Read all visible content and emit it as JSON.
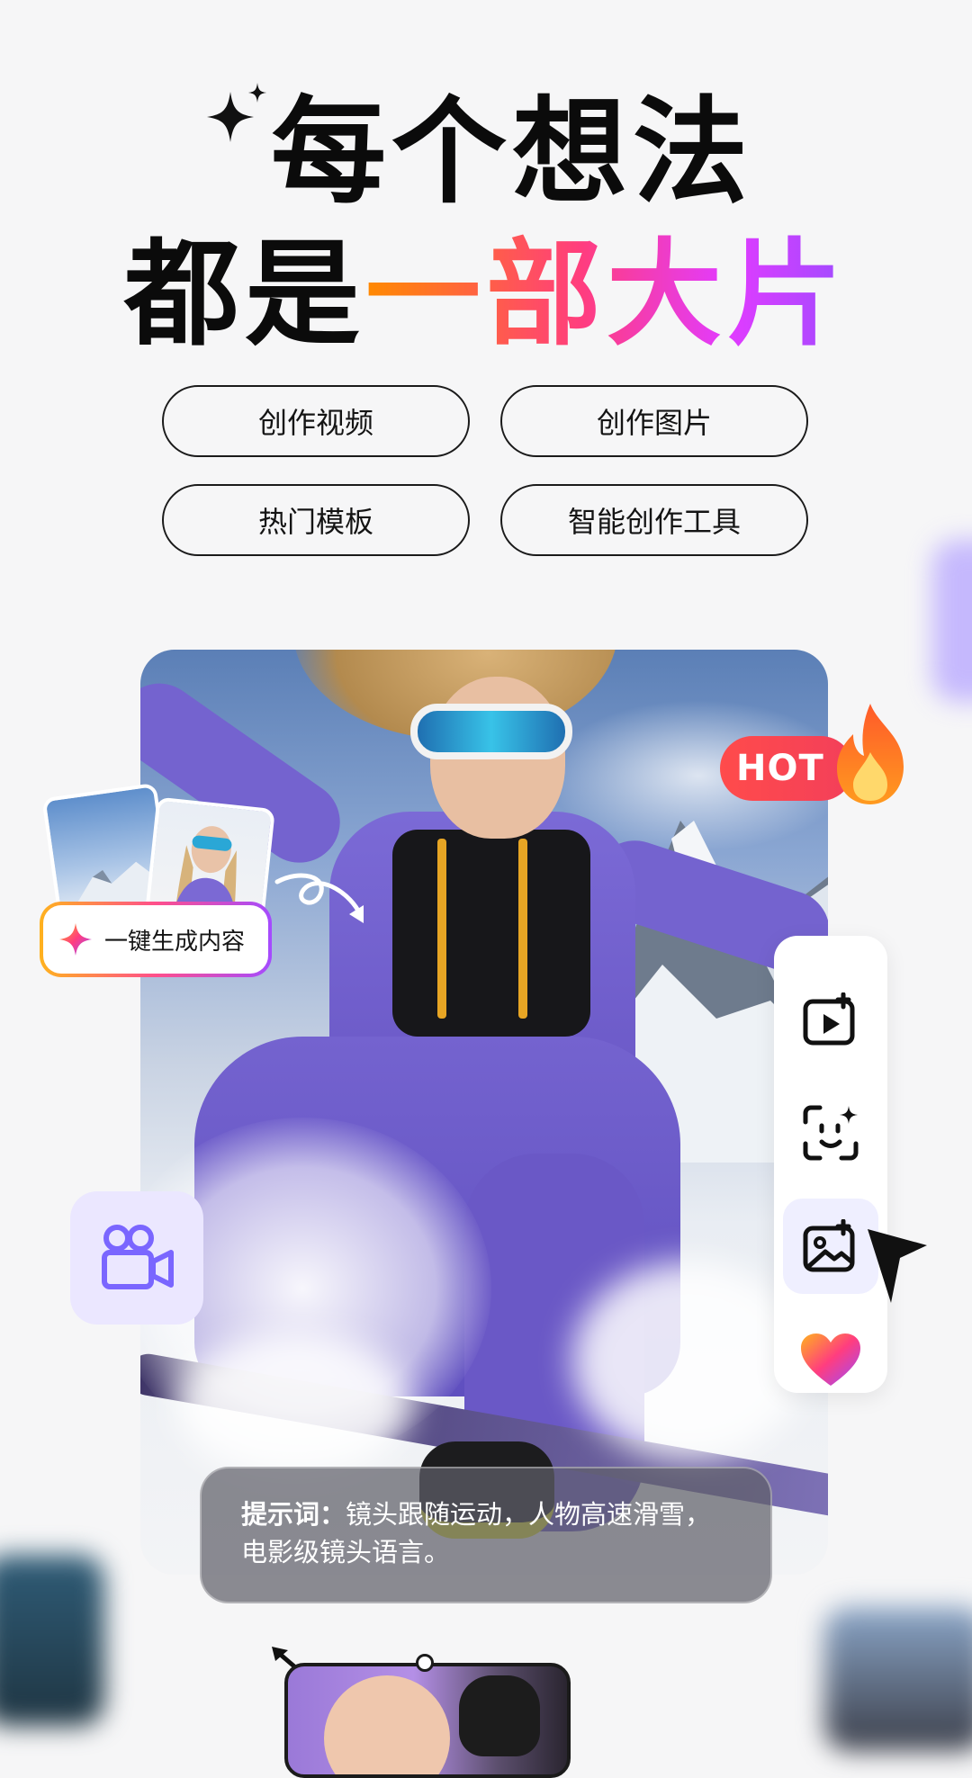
{
  "headline": {
    "line1": "每个想法",
    "line2_plain": "都是",
    "line2_gradient": "一部大片"
  },
  "actions": [
    {
      "label": "创作视频"
    },
    {
      "label": "创作图片"
    },
    {
      "label": "热门模板"
    },
    {
      "label": "智能创作工具"
    }
  ],
  "badge": {
    "hot": "HOT"
  },
  "generate_label": "一键生成内容",
  "prompt": {
    "prefix": "提示词：",
    "text": "镜头跟随运动，人物高速滑雪，电影级镜头语言。"
  },
  "toolbar": {
    "items": [
      {
        "icon": "video-generate-icon"
      },
      {
        "icon": "face-ai-icon"
      },
      {
        "icon": "image-generate-icon",
        "active": true
      },
      {
        "icon": "heart-icon"
      }
    ]
  },
  "colors": {
    "gradient": [
      "#ff8a00",
      "#ff3d7f",
      "#e23bff",
      "#a04bff"
    ],
    "hot": "#ff4b4b",
    "accent_purple": "#7a66ff"
  }
}
